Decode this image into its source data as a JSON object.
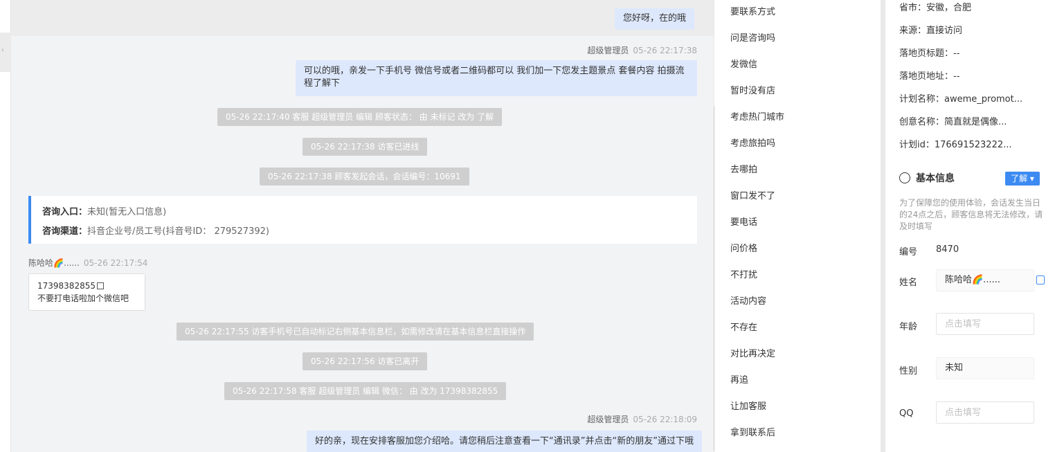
{
  "chat": {
    "messages": [
      {
        "text": "您好呀，在的哦"
      },
      {
        "sender": "超级管理员",
        "time": "05-26 22:17:38",
        "text": "可以的哦，亲发一下手机号 微信号或者二维码都可以 我们加一下您发主题景点 套餐内容 拍摄流程了解下"
      },
      {
        "sender": "超级管理员",
        "time": "05-26 22:18:09",
        "text": "好的亲，现在安排客服加您介绍哈。请您稍后注意查看一下“通讯录”并点击“新的朋友”通过下哦"
      }
    ],
    "system": [
      "05-26 22:17:40 客服 超级管理员 编辑 顾客状态： 由 未标记 改为 了解",
      "05-26 22:17:38 访客已进线",
      "05-26 22:17:38 顾客发起会话，会话编号：10691",
      "05-26 22:17:55 访客手机号已自动标记右侧基本信息栏，如需修改请在基本信息栏直接操作",
      "05-26 22:17:56 访客已离开",
      "05-26 22:17:58 客服 超级管理员 编辑 微信： 由 改为 17398382855"
    ],
    "entry": {
      "entry_label": "咨询入口：",
      "entry_value": "未知(暂无入口信息)",
      "channel_label": "咨询渠道：",
      "channel_value": "抖音企业号/员工号(抖音号ID： 279527392)"
    },
    "visitor": {
      "name": "陈哈哈🌈......",
      "time": "05-26 22:17:54",
      "phone": "17398382855",
      "text": "不要打电话啦加个微信吧"
    }
  },
  "quick_replies": [
    "要联系方式",
    "问是咨询吗",
    "发微信",
    "暂时没有店",
    "考虑热门城市",
    "考虑旅拍吗",
    "去哪拍",
    "窗口发不了",
    "要电话",
    "问价格",
    "不打扰",
    "活动内容",
    "不存在",
    "对比再决定",
    "再追",
    "让加客服",
    "拿到联系后"
  ],
  "info": {
    "province": "省市：安徽，合肥",
    "source": "来源：直接访问",
    "landing_title": "落地页标题：--",
    "landing_url": "落地页地址：--",
    "plan_name": "计划名称：aweme_promot...",
    "creative_name": "创意名称：简直就是偶像...",
    "plan_id": "计划id：176691523222...",
    "section_title": "基本信息",
    "status_button": "了解 ▾",
    "note": "为了保障您的使用体验，会话发生当日的24点之后，顾客信息将无法修改，请及时填写",
    "fields": {
      "id_label": "编号",
      "id_value": "8470",
      "name_label": "姓名",
      "name_value": "陈哈哈🌈......",
      "age_label": "年龄",
      "age_placeholder": "点击填写",
      "gender_label": "性别",
      "gender_value": "未知",
      "qq_label": "QQ",
      "qq_placeholder": "点击填写"
    }
  },
  "colors": {
    "accent": "#3d8bf2",
    "bubble": "#dde8fc",
    "system_bg": "#cfcfcf"
  },
  "icons": {
    "profile": "user-circle-icon",
    "copy": "copy-icon"
  }
}
